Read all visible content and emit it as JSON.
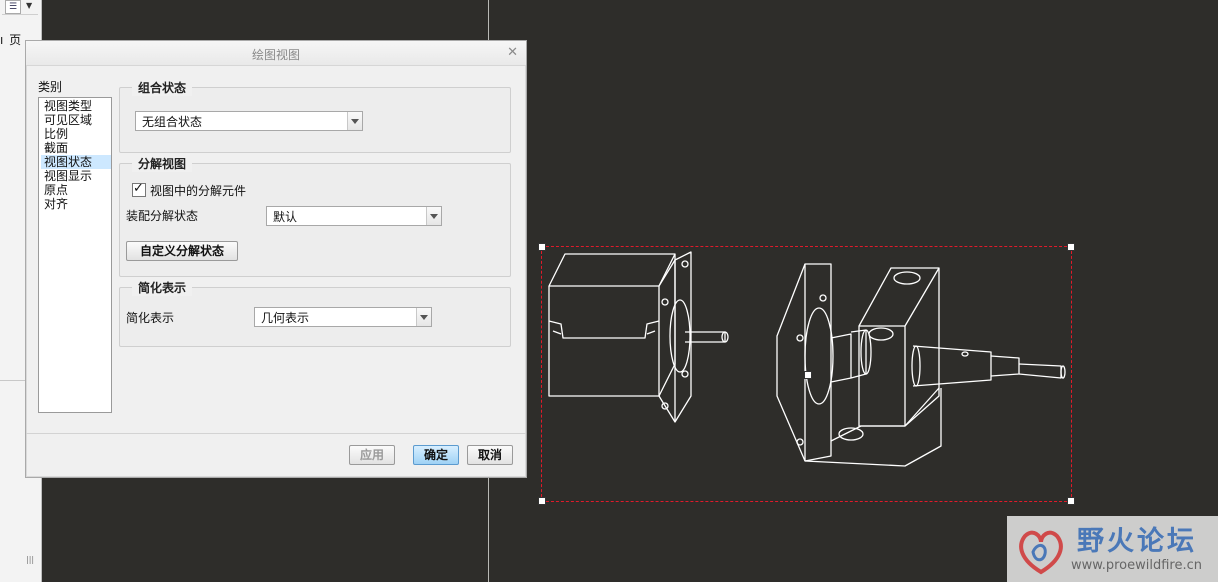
{
  "left_panel": {
    "side_text": "ı 页",
    "menu_icon": "list-icon"
  },
  "dialog": {
    "title": "绘图视图",
    "close_icon": "close-icon",
    "category_label": "类别",
    "categories": [
      "视图类型",
      "可见区域",
      "比例",
      "截面",
      "视图状态",
      "视图显示",
      "原点",
      "对齐"
    ],
    "selected_category": "视图状态",
    "combination_state": {
      "title": "组合状态",
      "value": "无组合状态"
    },
    "exploded_view": {
      "title": "分解视图",
      "checkbox_label": "视图中的分解元件",
      "checkbox_checked": true,
      "assembly_state_label": "装配分解状态",
      "assembly_state_value": "默认",
      "custom_button": "自定义分解状态"
    },
    "simplified_rep": {
      "title": "简化表示",
      "label": "简化表示",
      "value": "几何表示"
    },
    "buttons": {
      "apply": "应用",
      "ok": "确定",
      "cancel": "取消"
    }
  },
  "watermark": {
    "title": "野火论坛",
    "url": "www.proewildfire.cn"
  },
  "colors": {
    "canvas": "#2e2d2a",
    "selection": "#e01a2a",
    "accent": "#9fd2f5"
  }
}
